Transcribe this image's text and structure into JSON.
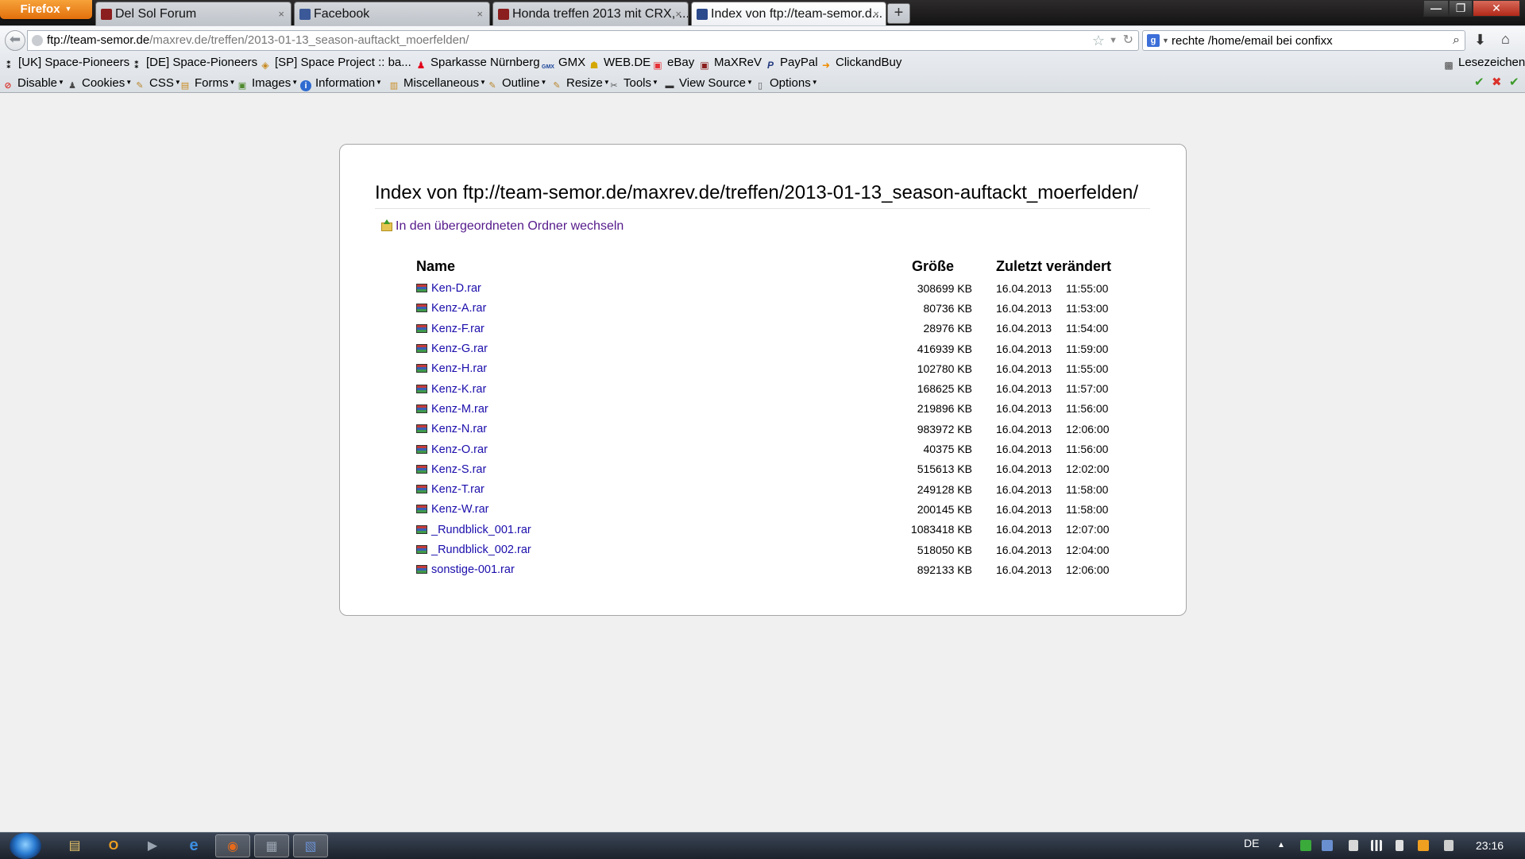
{
  "browser": {
    "menu_label": "Firefox",
    "tabs": [
      {
        "label": "Del Sol Forum",
        "favicon_color": "#8b1e1e"
      },
      {
        "label": "Facebook",
        "favicon_color": "#3b5998"
      },
      {
        "label": "Honda treffen 2013 mit CRX, ...",
        "favicon_color": "#8b1e1e"
      },
      {
        "label": "Index von ftp://team-semor.d...",
        "favicon_color": "#2b4a8c"
      }
    ],
    "tab_close_glyph": "×",
    "new_tab_glyph": "+",
    "window_controls": {
      "minimize": "—",
      "maximize": "❐",
      "close": "✕"
    }
  },
  "navbar": {
    "url_host": "ftp://team-semor.de",
    "url_path": "/maxrev.de/treffen/2013-01-13_season-auftackt_moerfelden/",
    "search_value": "rechte /home/email bei confixx",
    "search_engine_letter": "g"
  },
  "bookmarks": {
    "items": [
      {
        "label": "[UK] Space-Pioneers",
        "icon": "sp-icon",
        "color": "#000000"
      },
      {
        "label": "[DE] Space-Pioneers",
        "icon": "sp-icon",
        "color": "#000000"
      },
      {
        "label": "[SP] Space Project :: ba...",
        "icon": "diamond-icon",
        "color": "#c8881d"
      },
      {
        "label": "Sparkasse Nürnberg",
        "icon": "sparkasse-icon",
        "color": "#e2001a"
      },
      {
        "label": "GMX",
        "icon": "gmx-icon",
        "color": "#1c449b"
      },
      {
        "label": "WEB.DE",
        "icon": "webde-icon",
        "color": "#f2c200"
      },
      {
        "label": "eBay",
        "icon": "ebay-icon",
        "color": "#e53238"
      },
      {
        "label": "MaXReV",
        "icon": "maxrev-icon",
        "color": "#8b1e1e"
      },
      {
        "label": "PayPal",
        "icon": "paypal-icon",
        "color": "#253b80"
      },
      {
        "label": "ClickandBuy",
        "icon": "clickandbuy-icon",
        "color": "#f08c00"
      }
    ],
    "right_label": "Lesezeichen"
  },
  "devtoolbar": {
    "items": [
      {
        "label": "Disable",
        "icon": "disable-icon",
        "color": "#d9322b"
      },
      {
        "label": "Cookies",
        "icon": "cookies-icon",
        "color": "#4a4a4a"
      },
      {
        "label": "CSS",
        "icon": "css-icon",
        "color": "#2f6bd0"
      },
      {
        "label": "Forms",
        "icon": "forms-icon",
        "color": "#c98a1e"
      },
      {
        "label": "Images",
        "icon": "images-icon",
        "color": "#4f8a2e"
      },
      {
        "label": "Information",
        "icon": "information-icon",
        "color": "#2f6bd0"
      },
      {
        "label": "Miscellaneous",
        "icon": "miscellaneous-icon",
        "color": "#c98a1e"
      },
      {
        "label": "Outline",
        "icon": "outline-icon",
        "color": "#b8862b"
      },
      {
        "label": "Resize",
        "icon": "resize-icon",
        "color": "#b8862b"
      },
      {
        "label": "Tools",
        "icon": "tools-icon",
        "color": "#555555"
      },
      {
        "label": "View Source",
        "icon": "view-source-icon",
        "color": "#333333"
      },
      {
        "label": "Options",
        "icon": "options-icon",
        "color": "#555555"
      }
    ],
    "status": {
      "ok1": "✔",
      "error": "✖",
      "ok2": "✔"
    }
  },
  "listing": {
    "title": "Index von ftp://team-semor.de/maxrev.de/treffen/2013-01-13_season-auftackt_moerfelden/",
    "parent_link": "In den übergeordneten Ordner wechseln",
    "columns": {
      "name": "Name",
      "size": "Größe",
      "modified": "Zuletzt verändert"
    },
    "rows": [
      {
        "name": "Ken-D.rar",
        "size": "308699 KB",
        "date": "16.04.2013",
        "time": "11:55:00"
      },
      {
        "name": "Kenz-A.rar",
        "size": "80736 KB",
        "date": "16.04.2013",
        "time": "11:53:00"
      },
      {
        "name": "Kenz-F.rar",
        "size": "28976 KB",
        "date": "16.04.2013",
        "time": "11:54:00"
      },
      {
        "name": "Kenz-G.rar",
        "size": "416939 KB",
        "date": "16.04.2013",
        "time": "11:59:00"
      },
      {
        "name": "Kenz-H.rar",
        "size": "102780 KB",
        "date": "16.04.2013",
        "time": "11:55:00"
      },
      {
        "name": "Kenz-K.rar",
        "size": "168625 KB",
        "date": "16.04.2013",
        "time": "11:57:00"
      },
      {
        "name": "Kenz-M.rar",
        "size": "219896 KB",
        "date": "16.04.2013",
        "time": "11:56:00"
      },
      {
        "name": "Kenz-N.rar",
        "size": "983972 KB",
        "date": "16.04.2013",
        "time": "12:06:00"
      },
      {
        "name": "Kenz-O.rar",
        "size": "40375 KB",
        "date": "16.04.2013",
        "time": "11:56:00"
      },
      {
        "name": "Kenz-S.rar",
        "size": "515613 KB",
        "date": "16.04.2013",
        "time": "12:02:00"
      },
      {
        "name": "Kenz-T.rar",
        "size": "249128 KB",
        "date": "16.04.2013",
        "time": "11:58:00"
      },
      {
        "name": "Kenz-W.rar",
        "size": "200145 KB",
        "date": "16.04.2013",
        "time": "11:58:00"
      },
      {
        "name": "_Rundblick_001.rar",
        "size": "1083418 KB",
        "date": "16.04.2013",
        "time": "12:07:00"
      },
      {
        "name": "_Rundblick_002.rar",
        "size": "518050 KB",
        "date": "16.04.2013",
        "time": "12:04:00"
      },
      {
        "name": "sonstige-001.rar",
        "size": "892133 KB",
        "date": "16.04.2013",
        "time": "12:06:00"
      }
    ]
  },
  "taskbar": {
    "apps": [
      {
        "name": "explorer",
        "glyph": "▤",
        "color": "#e8c46a"
      },
      {
        "name": "outlook",
        "glyph": "O",
        "color": "#f0a020"
      },
      {
        "name": "media-player",
        "glyph": "▶",
        "color": "#9aa4b0"
      },
      {
        "name": "internet-explorer",
        "glyph": "e",
        "color": "#3c8ee0"
      },
      {
        "name": "firefox",
        "glyph": "◉",
        "color": "#e66a1a"
      },
      {
        "name": "app-6",
        "glyph": "▦",
        "color": "#9aa4b0"
      },
      {
        "name": "app-7",
        "glyph": "▧",
        "color": "#6a8fd0"
      }
    ],
    "language": "DE",
    "clock": "23:16"
  }
}
